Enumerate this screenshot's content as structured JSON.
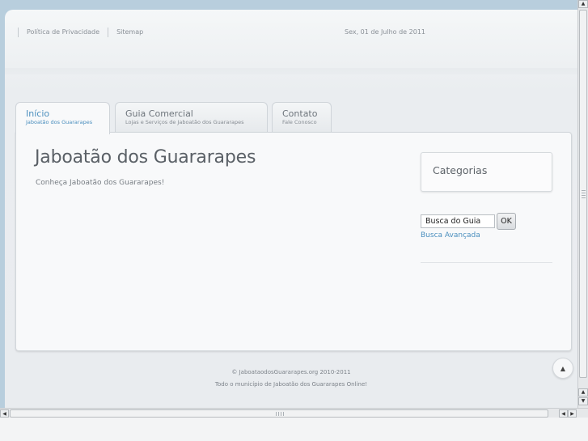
{
  "header": {
    "links": [
      "Política de Privacidade",
      "Sitemap"
    ],
    "date": "Sex, 01 de Julho de 2011"
  },
  "tabs": [
    {
      "title": "Início",
      "subtitle": "Jaboatão dos Guararapes",
      "active": true
    },
    {
      "title": "Guia Comercial",
      "subtitle": "Lojas e Serviços de Jaboatão dos Guararapes",
      "active": false
    },
    {
      "title": "Contato",
      "subtitle": "Fale Conosco",
      "active": false
    }
  ],
  "main": {
    "title": "Jaboatão dos Guararapes",
    "intro": "Conheça Jaboatão dos Guararapes!"
  },
  "sidebar": {
    "categories_title": "Categorias",
    "search_value": "Busca do Guia",
    "search_button": "OK",
    "advanced_link": "Busca Avançada"
  },
  "footer": {
    "copyright": "© JaboataodosGuararapes.org 2010-2011",
    "tagline": "Todo o município de Jaboatão dos Guararapes Online!"
  },
  "icons": {
    "back_to_top": "arrow-up-icon"
  },
  "colors": {
    "accent": "#4b8fbe",
    "frame": "#b8cedd"
  }
}
